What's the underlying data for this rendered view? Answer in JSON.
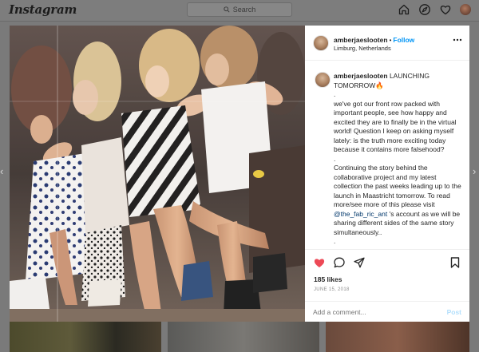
{
  "topbar": {
    "logo_text": "Instagram",
    "search_placeholder": "Search",
    "icons": [
      "home-icon",
      "direct-icon",
      "explore-icon",
      "activity-icon",
      "profile-avatar"
    ]
  },
  "post": {
    "header": {
      "username": "amberjaeslooten",
      "separator": "•",
      "follow_label": "Follow",
      "location": "Limburg, Netherlands"
    },
    "caption": {
      "username": "amberjaeslooten",
      "title": "LAUNCHING TOMORROW🔥",
      "dot1": ".",
      "para1": "we've got our front row packed with important people, see how happy and excited they are to finally be in the virtual world! Question I keep on asking myself lately: is the truth more exciting today because it contains more falsehood?",
      "dot2": ".",
      "para2_before": "Continuing the story behind the collaborative project and my latest collection the past weeks leading up to the launch in Maastricht tomorrow. To read more/see more of this please visit ",
      "mention": "@the_fab_ric_ant",
      "para2_after": " 's account as we will be sharing different sides of the same story simultaneously..",
      "dot3": "."
    },
    "likes": "185 likes",
    "date": "JUNE 15, 2018",
    "comment_placeholder": "Add a comment...",
    "post_label": "Post"
  },
  "colors": {
    "follow_blue": "#0095f6",
    "like_red": "#ed4956",
    "post_disabled": "#b2dffc",
    "overlay": "#7a7a7a"
  }
}
